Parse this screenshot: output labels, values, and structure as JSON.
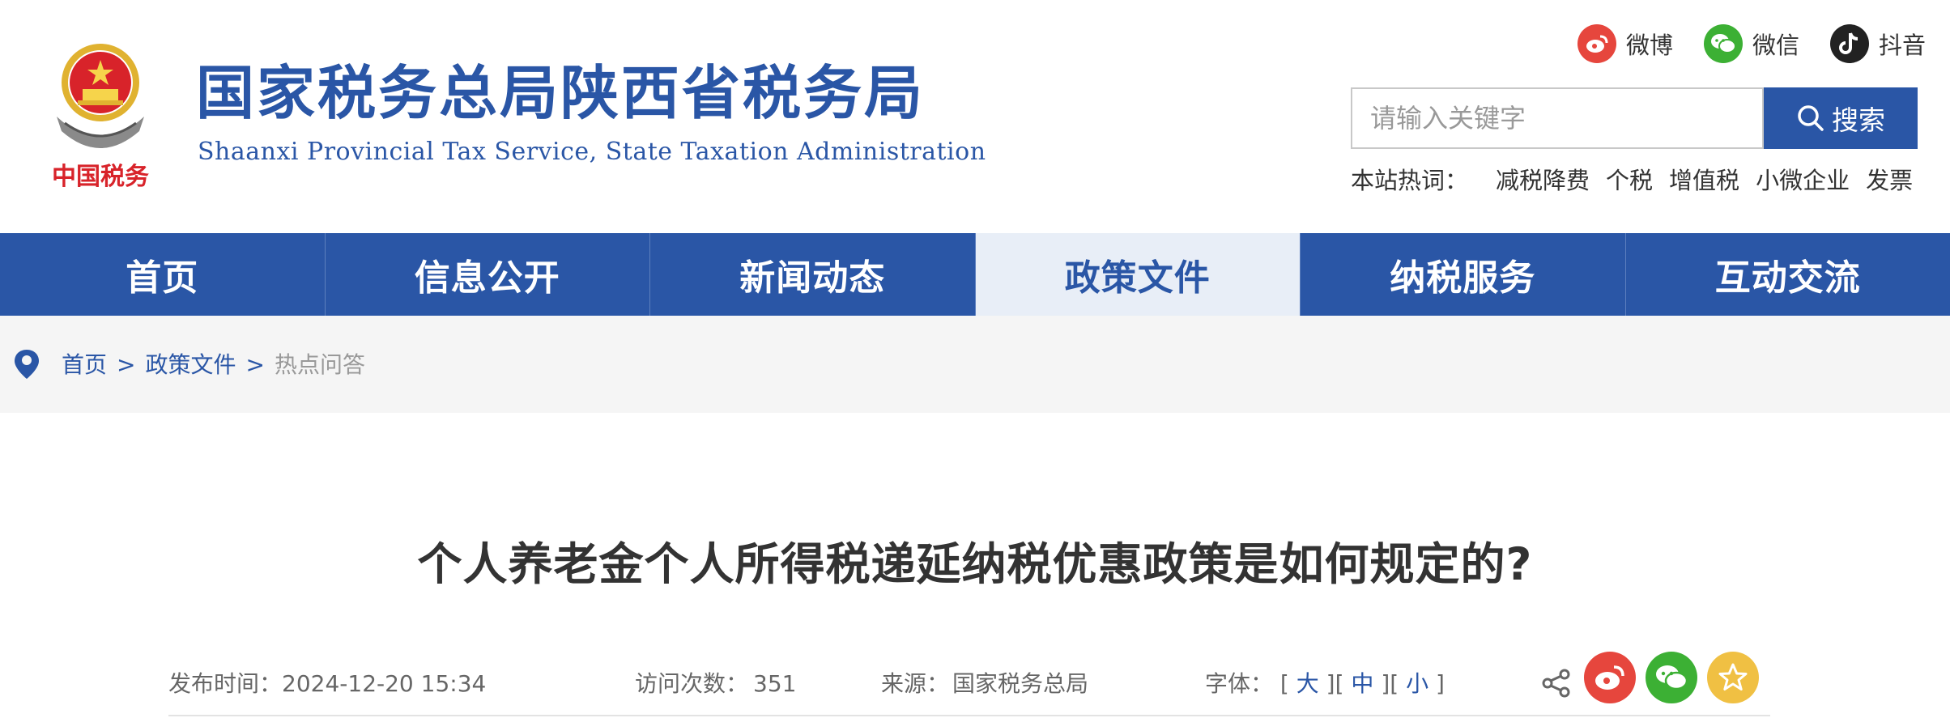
{
  "header": {
    "title_cn": "国家税务总局陕西省税务局",
    "title_en": "Shaanxi Provincial Tax Service, State Taxation Administration",
    "emblem_caption": "中国税务"
  },
  "social": [
    {
      "label": "微博",
      "icon": "weibo-icon",
      "color": "#e6463d"
    },
    {
      "label": "微信",
      "icon": "wechat-icon",
      "color": "#3cb034"
    },
    {
      "label": "抖音",
      "icon": "douyin-icon",
      "color": "#222222"
    }
  ],
  "search": {
    "placeholder": "请输入关键字",
    "button_label": "搜索"
  },
  "hotwords": {
    "label": "本站热词：",
    "items": [
      "减税降费",
      "个税",
      "增值税",
      "小微企业",
      "发票"
    ]
  },
  "nav": [
    {
      "label": "首页",
      "active": false
    },
    {
      "label": "信息公开",
      "active": false
    },
    {
      "label": "新闻动态",
      "active": false
    },
    {
      "label": "政策文件",
      "active": true
    },
    {
      "label": "纳税服务",
      "active": false
    },
    {
      "label": "互动交流",
      "active": false
    }
  ],
  "breadcrumb": {
    "home": "首页",
    "separator": ">",
    "section": "政策文件",
    "current": "热点问答"
  },
  "article": {
    "title": "个人养老金个人所得税递延纳税优惠政策是如何规定的?",
    "publish_label": "发布时间：",
    "publish_time": "2024-12-20 15:34",
    "visits_label": "访问次数：",
    "visits": "351",
    "source_label": "来源：",
    "source": "国家税务总局",
    "font_label": "字体：",
    "font_sizes": [
      "大",
      "中",
      "小"
    ]
  },
  "share": [
    {
      "icon": "weibo-icon",
      "color": "#e6463d"
    },
    {
      "icon": "wechat-icon",
      "color": "#3cb034"
    },
    {
      "icon": "favorite-icon",
      "color": "#f0c043"
    }
  ],
  "colors": {
    "brand_blue": "#2a56a6",
    "nav_active_bg": "#e8eef7",
    "breadcrumb_bg": "#f5f5f5"
  }
}
